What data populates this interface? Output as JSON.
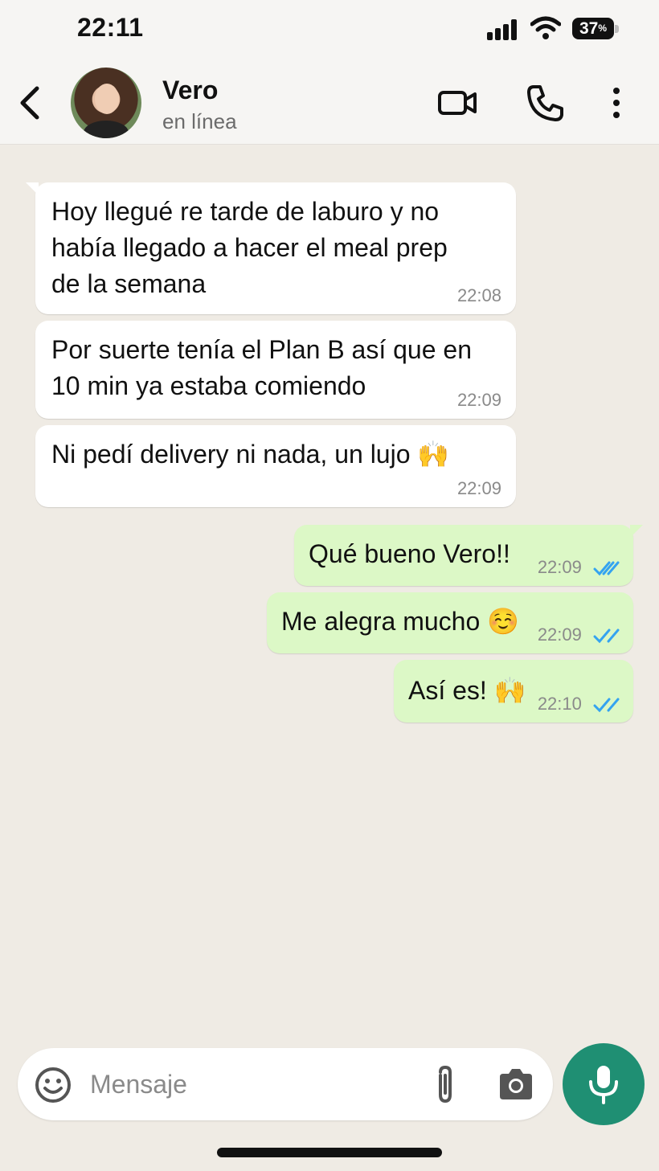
{
  "status_bar": {
    "time": "22:11",
    "battery": "37",
    "battery_unit": "%"
  },
  "header": {
    "name": "Vero",
    "status": "en línea"
  },
  "messages": [
    {
      "dir": "in",
      "lines": [
        "Hoy llegué re tarde de laburo y no",
        "había llegado a hacer el meal prep",
        "de la semana"
      ],
      "time": "22:08"
    },
    {
      "dir": "in",
      "lines": [
        "Por suerte tenía el Plan B así que en",
        "10 min ya estaba comiendo"
      ],
      "time": "22:09"
    },
    {
      "dir": "in",
      "text": "Ni pedí delivery ni nada, un lujo",
      "emoji": "🙌",
      "time": "22:09"
    },
    {
      "dir": "out",
      "text": "Qué bueno Vero!!",
      "time": "22:09",
      "read": true
    },
    {
      "dir": "out",
      "text": "Me alegra mucho",
      "emoji": "☺️",
      "time": "22:09",
      "read": true
    },
    {
      "dir": "out",
      "text": "Así es!",
      "emoji": "🙌",
      "time": "22:10",
      "read": true
    }
  ],
  "composer": {
    "placeholder": "Mensaje"
  },
  "colors": {
    "incoming": "#ffffff",
    "outgoing": "#dcf8c6",
    "accent": "#1f8f73",
    "read_ticks": "#34a3f0",
    "wallpaper": "#efebe4"
  },
  "icons": [
    "back-chevron-icon",
    "video-call-icon",
    "phone-icon",
    "more-vertical-icon",
    "emoji-icon",
    "paperclip-icon",
    "camera-icon",
    "mic-icon"
  ]
}
